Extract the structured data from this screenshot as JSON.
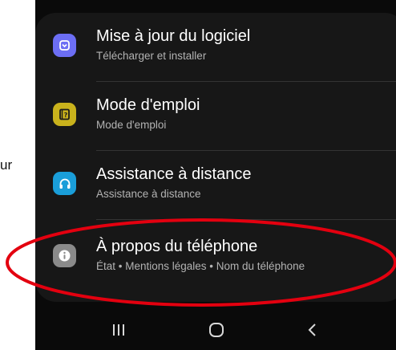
{
  "margin_text": "ur",
  "settings": {
    "items": [
      {
        "title": "Mise à jour du logiciel",
        "subtitle": "Télécharger et installer",
        "icon": "software-update-icon",
        "icon_color": "#6c6ef4"
      },
      {
        "title": "Mode d'emploi",
        "subtitle": "Mode d'emploi",
        "icon": "user-manual-icon",
        "icon_color": "#c9b21c"
      },
      {
        "title": "Assistance à distance",
        "subtitle": "Assistance à distance",
        "icon": "headset-icon",
        "icon_color": "#1a9ed9"
      },
      {
        "title": "À propos du téléphone",
        "subtitle": "État • Mentions légales • Nom du téléphone",
        "icon": "info-icon",
        "icon_color": "#8a8a8a"
      }
    ]
  },
  "navbar": {
    "recents": "recent-apps-icon",
    "home": "home-icon",
    "back": "back-icon"
  },
  "annotation": {
    "shape": "ellipse",
    "color": "#e3000f"
  }
}
